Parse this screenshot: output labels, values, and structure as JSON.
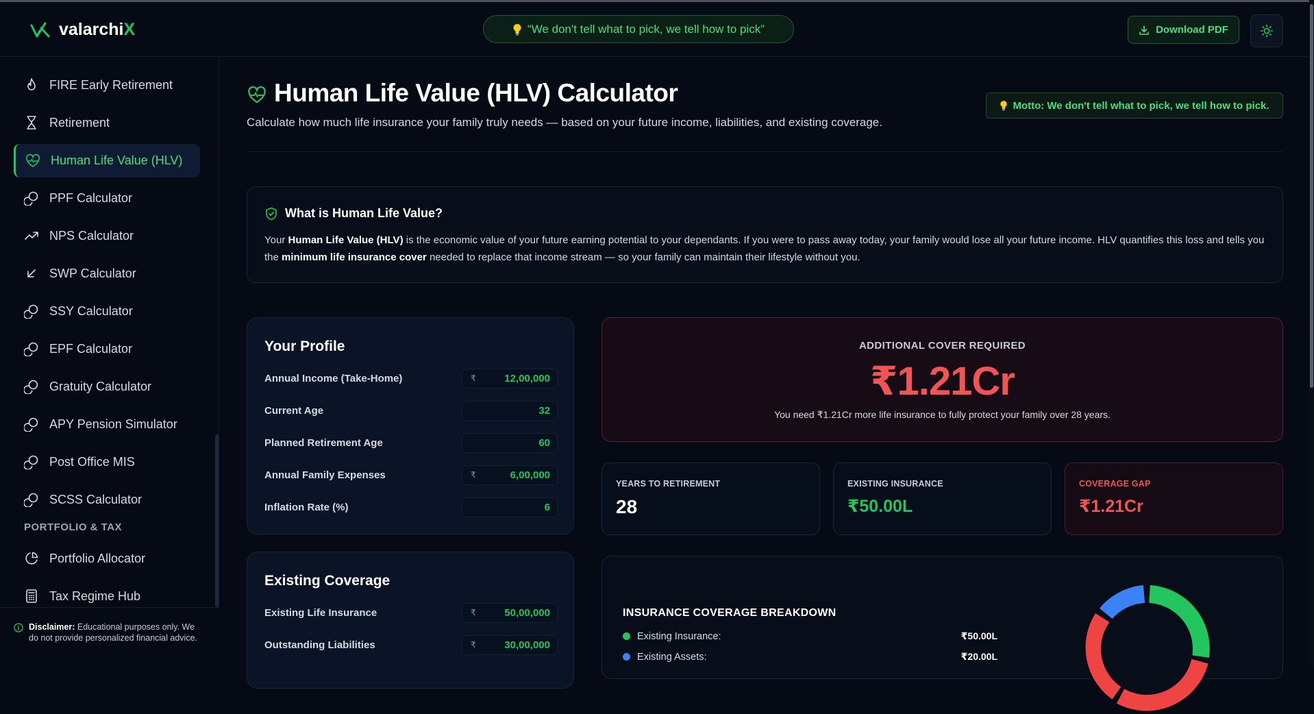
{
  "header": {
    "logo_text": "valarchi",
    "logo_accent": "X",
    "tagline": "“We don't tell what to pick, we tell how to pick”",
    "download_label": "Download PDF"
  },
  "sidebar": {
    "items": [
      {
        "label": "FIRE Early Retirement",
        "icon": "flame-icon"
      },
      {
        "label": "Retirement",
        "icon": "hourglass-icon"
      },
      {
        "label": "Human Life Value (HLV)",
        "icon": "heart-pulse-icon",
        "active": true
      },
      {
        "label": "PPF Calculator",
        "icon": "coins-icon"
      },
      {
        "label": "NPS Calculator",
        "icon": "trending-up-icon"
      },
      {
        "label": "SWP Calculator",
        "icon": "arrow-down-left-icon"
      },
      {
        "label": "SSY Calculator",
        "icon": "coins-icon"
      },
      {
        "label": "EPF Calculator",
        "icon": "coins-icon"
      },
      {
        "label": "Gratuity Calculator",
        "icon": "coins-icon"
      },
      {
        "label": "APY Pension Simulator",
        "icon": "coins-icon"
      },
      {
        "label": "Post Office MIS",
        "icon": "coins-icon"
      },
      {
        "label": "SCSS Calculator",
        "icon": "coins-icon"
      }
    ],
    "section_label": "PORTFOLIO & TAX",
    "section_items": [
      {
        "label": "Portfolio Allocator",
        "icon": "pie-chart-icon"
      },
      {
        "label": "Tax Regime Hub",
        "icon": "calculator-icon"
      }
    ],
    "disclaimer_bold": "Disclaimer:",
    "disclaimer_text": " Educational purposes only. We do not provide personalized financial advice."
  },
  "page": {
    "title": "Human Life Value (HLV) Calculator",
    "subtitle": "Calculate how much life insurance your family truly needs — based on your future income, liabilities, and existing coverage.",
    "motto": "Motto: We don't tell what to pick, we tell how to pick."
  },
  "info": {
    "title": "What is Human Life Value?",
    "p1": "Your ",
    "b1": "Human Life Value (HLV)",
    "p2": " is the economic value of your future earning potential to your dependants. If you were to pass away today, your family would lose all your future income. HLV quantifies this loss and tells you the ",
    "b2": "minimum life insurance cover",
    "p3": " needed to replace that income stream — so your family can maintain their lifestyle without you."
  },
  "profile": {
    "title": "Your Profile",
    "fields": [
      {
        "label": "Annual Income (Take-Home)",
        "currency": "₹",
        "value": "12,00,000"
      },
      {
        "label": "Current Age",
        "currency": "",
        "value": "32"
      },
      {
        "label": "Planned Retirement Age",
        "currency": "",
        "value": "60"
      },
      {
        "label": "Annual Family Expenses",
        "currency": "₹",
        "value": "6,00,000"
      },
      {
        "label": "Inflation Rate (%)",
        "currency": "",
        "value": "6"
      }
    ]
  },
  "coverage": {
    "title": "Existing Coverage",
    "fields": [
      {
        "label": "Existing Life Insurance",
        "currency": "₹",
        "value": "50,00,000"
      },
      {
        "label": "Outstanding Liabilities",
        "currency": "₹",
        "value": "30,00,000"
      }
    ]
  },
  "result": {
    "label": "ADDITIONAL COVER REQUIRED",
    "value": "₹1.21Cr",
    "note": "You need ₹1.21Cr more life insurance to fully protect your family over 28 years."
  },
  "stats": [
    {
      "label": "YEARS TO RETIREMENT",
      "value": "28"
    },
    {
      "label": "EXISTING INSURANCE",
      "value": "₹50.00L"
    },
    {
      "label": "COVERAGE GAP",
      "value": "₹1.21Cr"
    }
  ],
  "breakdown": {
    "title": "INSURANCE COVERAGE BREAKDOWN",
    "items": [
      {
        "label": "Existing Insurance:",
        "value": "₹50.00L"
      },
      {
        "label": "Existing Assets:",
        "value": "₹20.00L"
      }
    ]
  },
  "colors": {
    "accent": "#22c55e",
    "danger": "#f05454",
    "assets": "#3b82f6",
    "gap": "#ef4444"
  }
}
